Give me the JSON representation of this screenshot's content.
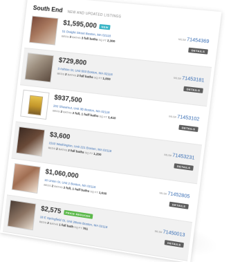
{
  "header": {
    "title": "South End",
    "subtitle": "NEW AND UPDATED LISTINGS"
  },
  "colors": {
    "badge_new": "#3ab5c6",
    "badge_price": "#5bb84a",
    "link": "#3a6fb5",
    "button": "#5e5e5e"
  },
  "listings": [
    {
      "price": "$1,595,000",
      "badge": "NEW",
      "address": "51 Dwight Street Boston, MA 02118",
      "beds": "3",
      "baths": "3 full baths",
      "sqft": "2,300",
      "mls_label": "MLS#",
      "mls": "71454369",
      "details_label": "DETAILS"
    },
    {
      "price": "$729,800",
      "badge": "",
      "address": "3 Ashton St, Unit 603 Boston, MA 02118",
      "beds": "2",
      "baths": "2 full baths",
      "sqft": "1,000",
      "mls_label": "MLS#",
      "mls": "71453181",
      "details_label": "DETAILS"
    },
    {
      "price": "$937,500",
      "badge": "",
      "address": "202 Shawmut, Unit 3B Boston, MA 02118",
      "beds": "2",
      "baths": "2 full, 1 half baths",
      "sqft": "1,410",
      "mls_label": "MLS#",
      "mls": "71453102",
      "details_label": "DETAILS"
    },
    {
      "price": "$3,600",
      "badge": "",
      "address": "1510 Washington, Unit 221 Boston, MA 02118",
      "beds": "2",
      "baths": "2 full baths",
      "sqft": "1,200",
      "mls_label": "MLS#",
      "mls": "71453231",
      "details_label": "DETAILS"
    },
    {
      "price": "$1,060,000",
      "badge": "",
      "address": "16 Union St, Unit 2 Boston, MA 02118",
      "beds": "2",
      "baths": "2 full, 1 half baths",
      "sqft": "1,616",
      "mls_label": "MLS#",
      "mls": "71452805",
      "details_label": "DETAILS"
    },
    {
      "price": "$2,575",
      "badge": "PRICE REDUCED",
      "address": "18 E Springfield St, Unit 2Boss Boston, MA 02118",
      "beds": "2",
      "baths": "1 full bath",
      "sqft": "761",
      "mls_label": "MLS#",
      "mls": "71450013",
      "details_label": "DETAILS"
    }
  ]
}
